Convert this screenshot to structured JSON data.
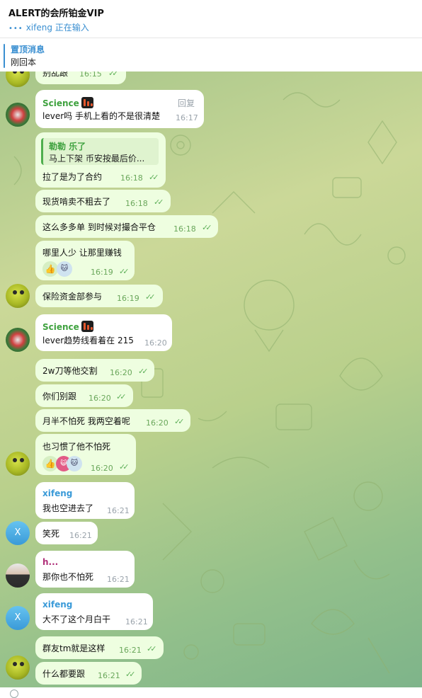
{
  "header": {
    "title": "ALERT的会所铂金VIP",
    "typing_user": "xifeng",
    "typing_text": "正在输入"
  },
  "pinned": {
    "title": "置顶消息",
    "text": "刚回本"
  },
  "messages": [
    {
      "text": "别乱跟",
      "time": "16:15"
    },
    {
      "sender": "Science",
      "text": "lever吗 手机上看的不是很清楚",
      "time": "16:17",
      "reply_label": "回复"
    },
    {
      "quote_name": "勒勒 乐了",
      "quote_text": "马上下架 币安按最后价...",
      "text": "拉了是为了合约",
      "time": "16:18"
    },
    {
      "text": "现货啃卖不粗去了",
      "time": "16:18"
    },
    {
      "text": "这么多多单 到时候对撮合平仓",
      "time": "16:18"
    },
    {
      "text": "哪里人少 让那里赚钱",
      "time": "16:19",
      "reactions": [
        "👍",
        "🐱"
      ]
    },
    {
      "text": "保险资金部参与",
      "time": "16:19"
    },
    {
      "sender": "Science",
      "text": "lever趋势线看着在 215",
      "time": "16:20"
    },
    {
      "text": "2w刀等他交割",
      "time": "16:20"
    },
    {
      "text": "你们别跟",
      "time": "16:20"
    },
    {
      "text": "月半不怕死 我两空着呢",
      "time": "16:20"
    },
    {
      "text": "也习惯了他不怕死",
      "time": "16:20",
      "reactions": [
        "👍",
        "😺",
        "🐱"
      ]
    },
    {
      "sender": "xifeng",
      "text": "我也空进去了",
      "time": "16:21"
    },
    {
      "text": "笑死",
      "time": "16:21"
    },
    {
      "sender": "h...",
      "text": "那你也不怕死",
      "time": "16:21"
    },
    {
      "sender": "xifeng",
      "text": "大不了这个月白干",
      "time": "16:21"
    },
    {
      "text": "群友tm就是这样",
      "time": "16:21"
    },
    {
      "text": "什么都要跟",
      "time": "16:21"
    }
  ],
  "avatars": {
    "xifeng_initial": "X"
  },
  "colors": {
    "accent": "#3a8fd1",
    "outgoing_bubble": "#eefee0",
    "sender_science": "#3fa23f",
    "sender_xifeng": "#3a9ad8",
    "sender_h": "#b0307a"
  }
}
